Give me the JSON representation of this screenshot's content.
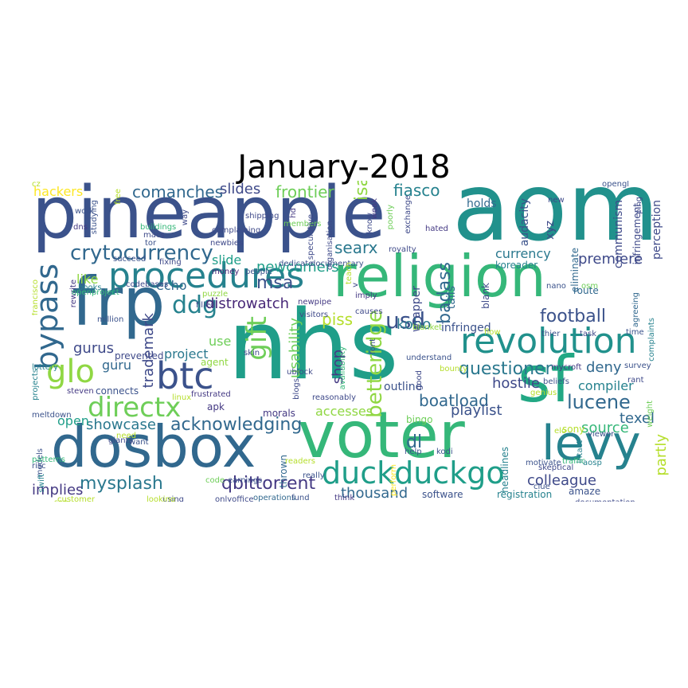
{
  "title": "January-2018",
  "words": [
    {
      "text": "aom",
      "color": "#21918c"
    },
    {
      "text": "pineapple",
      "color": "#3b528b"
    },
    {
      "text": "nhs",
      "color": "#1f9e89"
    },
    {
      "text": "religion",
      "color": "#35b779"
    },
    {
      "text": "frp",
      "color": "#31688e"
    },
    {
      "text": "sf",
      "color": "#22a884"
    },
    {
      "text": "voter",
      "color": "#35b779"
    },
    {
      "text": "dosbox",
      "color": "#31688e"
    },
    {
      "text": "levy",
      "color": "#26828e"
    },
    {
      "text": "procedures",
      "color": "#26828e"
    },
    {
      "text": "revolution",
      "color": "#21918c"
    },
    {
      "text": "btc",
      "color": "#3b528b"
    },
    {
      "text": "duckduckgo",
      "color": "#1f9e89"
    },
    {
      "text": "bypass",
      "color": "#31688e"
    },
    {
      "text": "glo",
      "color": "#90d743"
    },
    {
      "text": "directx",
      "color": "#6ece58"
    },
    {
      "text": "ddg",
      "color": "#26828e"
    },
    {
      "text": "crytocurrency",
      "color": "#31688e"
    },
    {
      "text": "usd",
      "color": "#3b528b"
    },
    {
      "text": "questioner",
      "color": "#2a788e"
    },
    {
      "text": "gift",
      "color": "#6ece58"
    },
    {
      "text": "qbittorrent",
      "color": "#443983"
    },
    {
      "text": "mysplash",
      "color": "#2a788e"
    },
    {
      "text": "acknowledging",
      "color": "#31688e"
    },
    {
      "text": "lucene",
      "color": "#31688e"
    },
    {
      "text": "football",
      "color": "#3b528b"
    },
    {
      "text": "betteridge",
      "color": "#90d743"
    },
    {
      "text": "comanches",
      "color": "#31688e"
    },
    {
      "text": "isa",
      "color": "#90d743"
    },
    {
      "text": "fiasco",
      "color": "#26828e"
    },
    {
      "text": "frontier",
      "color": "#6ece58"
    },
    {
      "text": "slides",
      "color": "#3e4989"
    },
    {
      "text": "hackers",
      "color": "#fde725"
    },
    {
      "text": "searx",
      "color": "#2a788e"
    },
    {
      "text": "msa",
      "color": "#3b528b"
    },
    {
      "text": "newcomers",
      "color": "#1f9e89"
    },
    {
      "text": "distrowatch",
      "color": "#482878"
    },
    {
      "text": "trademark",
      "color": "#3e4989"
    },
    {
      "text": "usability",
      "color": "#6ece58"
    },
    {
      "text": "badass",
      "color": "#31688e"
    },
    {
      "text": "piss",
      "color": "#b5de2b"
    },
    {
      "text": "kobo",
      "color": "#2a788e"
    },
    {
      "text": "shop",
      "color": "#443983"
    },
    {
      "text": "accesses",
      "color": "#90d743"
    },
    {
      "text": "boatload",
      "color": "#31688e"
    },
    {
      "text": "hostile",
      "color": "#3e4989"
    },
    {
      "text": "playlist",
      "color": "#3b528b"
    },
    {
      "text": "deny",
      "color": "#31688e"
    },
    {
      "text": "compiler",
      "color": "#26828e"
    },
    {
      "text": "texel",
      "color": "#31688e"
    },
    {
      "text": "source",
      "color": "#35b779"
    },
    {
      "text": "colleague",
      "color": "#3e4989"
    },
    {
      "text": "thousand",
      "color": "#31688e"
    },
    {
      "text": "showcase",
      "color": "#2a788e"
    },
    {
      "text": "implies",
      "color": "#443983"
    },
    {
      "text": "gurus",
      "color": "#3e4989"
    },
    {
      "text": "guru",
      "color": "#31688e"
    },
    {
      "text": "project",
      "color": "#2a788e"
    },
    {
      "text": "slide",
      "color": "#1f9e89"
    },
    {
      "text": "echo",
      "color": "#31688e"
    },
    {
      "text": "like",
      "color": "#90d743"
    },
    {
      "text": "open",
      "color": "#1f9e89"
    },
    {
      "text": "use",
      "color": "#6ece58"
    },
    {
      "text": "dl",
      "color": "#31688e"
    },
    {
      "text": "premiere",
      "color": "#3e4989"
    },
    {
      "text": "currency",
      "color": "#2a788e"
    },
    {
      "text": "partly",
      "color": "#b5de2b"
    },
    {
      "text": "communism",
      "color": "#3e4989"
    },
    {
      "text": "audacity",
      "color": "#3b528b"
    },
    {
      "text": "eliminate",
      "color": "#31688e"
    },
    {
      "text": "holds",
      "color": "#31688e"
    },
    {
      "text": "xyz",
      "color": "#3e4989"
    },
    {
      "text": "infringed",
      "color": "#3b528b"
    },
    {
      "text": "wrapper",
      "color": "#3e4989"
    },
    {
      "text": "tails",
      "color": "#31688e"
    },
    {
      "text": "perception",
      "color": "#3e4989"
    },
    {
      "text": "infringement",
      "color": "#3e4989"
    },
    {
      "text": "koreader",
      "color": "#26828e"
    },
    {
      "text": "blank",
      "color": "#3e4989"
    },
    {
      "text": "route",
      "color": "#31688e"
    },
    {
      "text": "sony",
      "color": "#b5de2b"
    },
    {
      "text": "amaze",
      "color": "#3b528b"
    },
    {
      "text": "registration",
      "color": "#26828e"
    },
    {
      "text": "software",
      "color": "#3b528b"
    },
    {
      "text": "outline",
      "color": "#3b528b"
    },
    {
      "text": "bingo",
      "color": "#6ece58"
    },
    {
      "text": "morals",
      "color": "#443983"
    },
    {
      "text": "thrown",
      "color": "#31688e"
    },
    {
      "text": "agent",
      "color": "#90d743"
    },
    {
      "text": "prevented",
      "color": "#3e4989"
    },
    {
      "text": "connects",
      "color": "#3b528b"
    },
    {
      "text": "apk",
      "color": "#443983"
    },
    {
      "text": "frustrated",
      "color": "#443983"
    },
    {
      "text": "earnings",
      "color": "#3b528b"
    },
    {
      "text": "code",
      "color": "#6ece58"
    },
    {
      "text": "operations",
      "color": "#31688e"
    },
    {
      "text": "fund",
      "color": "#3b528b"
    },
    {
      "text": "think",
      "color": "#443983"
    },
    {
      "text": "help",
      "color": "#3b528b"
    },
    {
      "text": "kodi",
      "color": "#3b528b"
    },
    {
      "text": "perform",
      "color": "#fde725"
    },
    {
      "text": "headlines",
      "color": "#26828e"
    },
    {
      "text": "traffic",
      "color": "#35b779"
    },
    {
      "text": "aosp",
      "color": "#26828e"
    },
    {
      "text": "motivate",
      "color": "#3b528b"
    },
    {
      "text": "clue",
      "color": "#3b528b"
    },
    {
      "text": "documentation",
      "color": "#3e4989"
    },
    {
      "text": "genius",
      "color": "#b5de2b"
    },
    {
      "text": "beliefs",
      "color": "#3b528b"
    },
    {
      "text": "mycroft",
      "color": "#443983"
    },
    {
      "text": "flow",
      "color": "#b5de2b"
    },
    {
      "text": "task",
      "color": "#3e4989"
    },
    {
      "text": "thier",
      "color": "#3b528b"
    },
    {
      "text": "time",
      "color": "#3b528b"
    },
    {
      "text": "rant",
      "color": "#3e4989"
    },
    {
      "text": "survey",
      "color": "#3b528b"
    },
    {
      "text": "complaints",
      "color": "#26828e"
    },
    {
      "text": "agreeing",
      "color": "#31688e"
    },
    {
      "text": "osm",
      "color": "#6ece58"
    },
    {
      "text": "ping",
      "color": "#3e4989"
    },
    {
      "text": "new",
      "color": "#3e4989"
    },
    {
      "text": "opengl",
      "color": "#3b528b"
    },
    {
      "text": "weak",
      "color": "#443983"
    },
    {
      "text": "poorly",
      "color": "#6ece58"
    },
    {
      "text": "exchange",
      "color": "#3e4989"
    },
    {
      "text": "hated",
      "color": "#443983"
    },
    {
      "text": "royalty",
      "color": "#3e4989"
    },
    {
      "text": "documentary",
      "color": "#3b528b"
    },
    {
      "text": "dedicate",
      "color": "#3b528b"
    },
    {
      "text": "people",
      "color": "#3b528b"
    },
    {
      "text": "money",
      "color": "#482878"
    },
    {
      "text": "fixing",
      "color": "#3e4989"
    },
    {
      "text": "succeed",
      "color": "#3b528b"
    },
    {
      "text": "rewrite",
      "color": "#443983"
    },
    {
      "text": "codebases",
      "color": "#3e4989"
    },
    {
      "text": "newpipe",
      "color": "#443983"
    },
    {
      "text": "puzzle",
      "color": "#90d743"
    },
    {
      "text": "filled",
      "color": "#3e4989"
    },
    {
      "text": "visitors",
      "color": "#3e4989"
    },
    {
      "text": "blanket",
      "color": "#90d743"
    },
    {
      "text": "imply",
      "color": "#443983"
    },
    {
      "text": "causes",
      "color": "#3e4989"
    },
    {
      "text": "font",
      "color": "#3b528b"
    },
    {
      "text": "understand",
      "color": "#3b528b"
    },
    {
      "text": "bounty",
      "color": "#b5de2b"
    },
    {
      "text": "good",
      "color": "#3e4989"
    },
    {
      "text": "ublock",
      "color": "#3e4989"
    },
    {
      "text": "skin",
      "color": "#3e4989"
    },
    {
      "text": "blogs",
      "color": "#3e4989"
    },
    {
      "text": "reasonably",
      "color": "#3e4989"
    },
    {
      "text": "readers",
      "color": "#b5de2b"
    },
    {
      "text": "really",
      "color": "#3b528b"
    },
    {
      "text": "using",
      "color": "#3e4989"
    },
    {
      "text": "onlyoffice",
      "color": "#3e4989"
    },
    {
      "text": "looking",
      "color": "#b5de2b"
    },
    {
      "text": "want",
      "color": "#3b528b"
    },
    {
      "text": "giants",
      "color": "#3e4989"
    },
    {
      "text": "need",
      "color": "#b5de2b"
    },
    {
      "text": "customer",
      "color": "#b5de2b"
    },
    {
      "text": "san",
      "color": "#b5de2b"
    },
    {
      "text": "models",
      "color": "#3b528b"
    },
    {
      "text": "swift",
      "color": "#26828e"
    },
    {
      "text": "patterns",
      "color": "#35b779"
    },
    {
      "text": "risc",
      "color": "#3b528b"
    },
    {
      "text": "meltdown",
      "color": "#3b528b"
    },
    {
      "text": "projects",
      "color": "#26828e"
    },
    {
      "text": "lottery",
      "color": "#26828e"
    },
    {
      "text": "steven",
      "color": "#443983"
    },
    {
      "text": "linux",
      "color": "#b5de2b"
    },
    {
      "text": "francisco",
      "color": "#b5de2b"
    },
    {
      "text": "openproject",
      "color": "#35b779"
    },
    {
      "text": "books",
      "color": "#26828e"
    },
    {
      "text": "million",
      "color": "#3b528b"
    },
    {
      "text": "free",
      "color": "#b5de2b"
    },
    {
      "text": "studying",
      "color": "#3b528b"
    },
    {
      "text": "buildings",
      "color": "#35b779"
    },
    {
      "text": "macs",
      "color": "#3e4989"
    },
    {
      "text": "tor",
      "color": "#3b528b"
    },
    {
      "text": "dns",
      "color": "#443983"
    },
    {
      "text": "work",
      "color": "#3b528b"
    },
    {
      "text": "way",
      "color": "#3e4989"
    },
    {
      "text": "complaining",
      "color": "#3e4989"
    },
    {
      "text": "newbies",
      "color": "#3e4989"
    },
    {
      "text": "members",
      "color": "#6ece58"
    },
    {
      "text": "hd",
      "color": "#443983"
    },
    {
      "text": "speculative",
      "color": "#3e4989"
    },
    {
      "text": "organisation",
      "color": "#3e4989"
    },
    {
      "text": "know",
      "color": "#3e4989"
    },
    {
      "text": "shipping",
      "color": "#3e4989"
    },
    {
      "text": "viewer",
      "color": "#3b528b"
    },
    {
      "text": "elo",
      "color": "#b5de2b"
    },
    {
      "text": "weight",
      "color": "#6ece58"
    },
    {
      "text": "intact",
      "color": "#26828e"
    },
    {
      "text": "availability",
      "color": "#35b779"
    },
    {
      "text": "nano",
      "color": "#3b528b"
    },
    {
      "text": "v",
      "color": "#3e4989"
    },
    {
      "text": "teach",
      "color": "#b5de2b"
    },
    {
      "text": "skeptical",
      "color": "#3e4989"
    },
    {
      "text": "cz",
      "color": "#b5de2b"
    }
  ]
}
